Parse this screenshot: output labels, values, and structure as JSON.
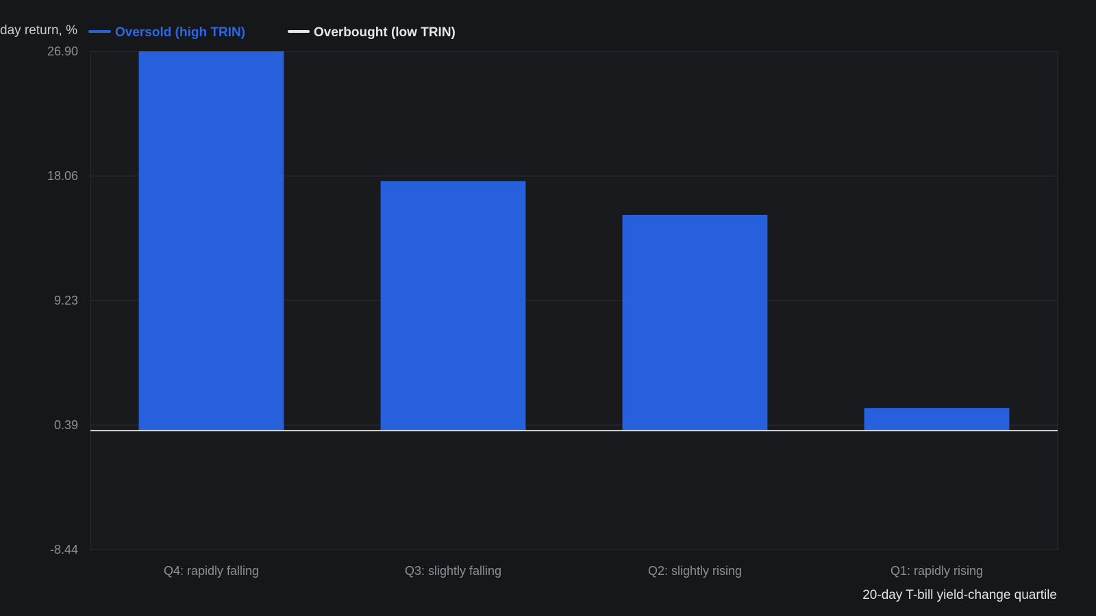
{
  "chart_data": {
    "type": "bar",
    "ylabel": "day return, %",
    "xlabel": "20-day T-bill yield-change quartile",
    "categories": [
      "Q4: rapidly falling",
      "Q3: slightly falling",
      "Q2: slightly rising",
      "Q1: rapidly rising"
    ],
    "series": [
      {
        "name": "Oversold (high TRIN)",
        "color": "#2660dd",
        "values": [
          26.9,
          17.7,
          15.3,
          1.6
        ]
      },
      {
        "name": "Overbought (low TRIN)",
        "color": "#e6e6e6",
        "values": [
          0.0,
          0.0,
          0.0,
          0.0
        ]
      }
    ],
    "yticks": [
      "26.90",
      "18.06",
      "9.23",
      "0.39",
      "-8.44"
    ],
    "ylim": [
      -8.44,
      26.9
    ],
    "grid": true,
    "legend_position": "top-left",
    "colors": {
      "background": "#161719",
      "plot_background": "#181a1e",
      "grid": "#2a2d33",
      "zero_line": "#d9d9d9"
    }
  }
}
